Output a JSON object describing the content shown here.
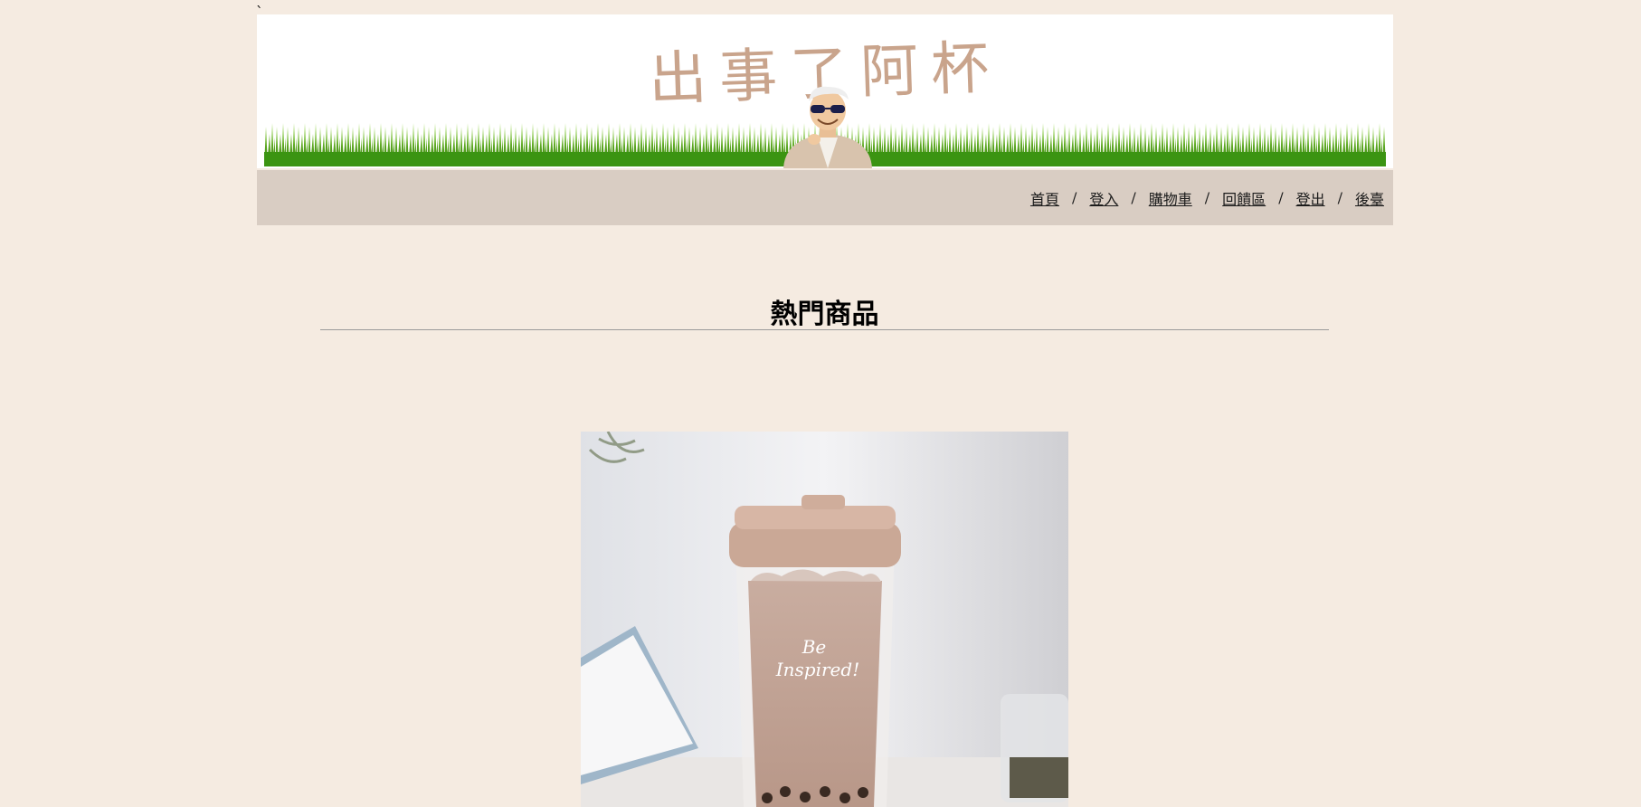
{
  "stray_char": "`",
  "banner": {
    "title": "出事了阿杯"
  },
  "nav": {
    "items": [
      "首頁",
      "登入",
      "購物車",
      "回饋區",
      "登出",
      "後臺"
    ],
    "separator": "/"
  },
  "section": {
    "title": "熱門商品"
  },
  "product_image": {
    "cup_text_line1": "Be",
    "cup_text_line2": "Inspired!"
  },
  "colors": {
    "page_background": "#f5ebe1",
    "nav_background": "#d9cdc3",
    "title_color": "#c9a48c",
    "grass_green": "#4aa817"
  }
}
